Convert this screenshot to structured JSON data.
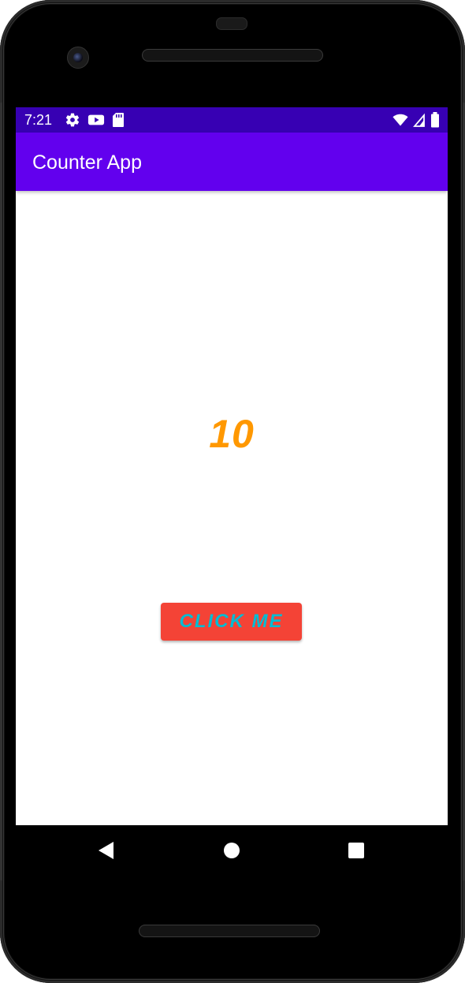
{
  "status_bar": {
    "time": "7:21",
    "left_icons": [
      "settings-gear-icon",
      "youtube-icon",
      "sd-card-icon"
    ],
    "right_icons": [
      "wifi-icon",
      "cell-signal-icon",
      "battery-icon"
    ],
    "color": "#3700b3"
  },
  "app_bar": {
    "title": "Counter App",
    "color": "#6200ee"
  },
  "main": {
    "counter_value": "10",
    "counter_color": "#ff9800",
    "button_label": "CLICK ME",
    "button_color": "#f44336",
    "button_text_color": "#00bcd4"
  },
  "nav_bar": {
    "buttons": [
      "back-icon",
      "home-icon",
      "recents-icon"
    ]
  }
}
